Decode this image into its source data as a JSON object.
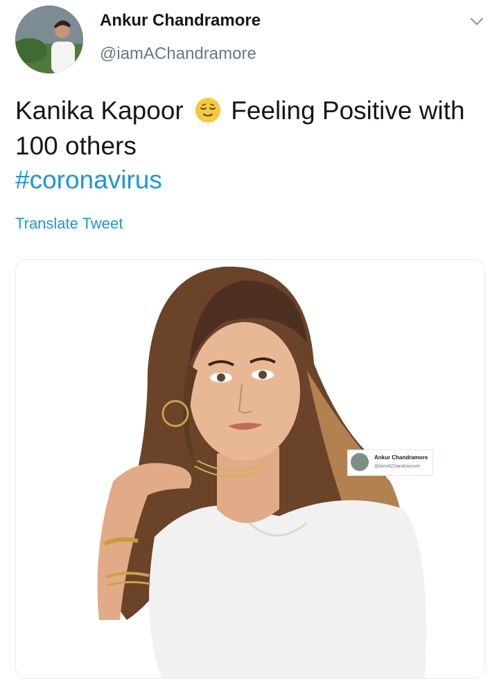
{
  "tweet": {
    "author": {
      "display_name": "Ankur Chandramore",
      "handle": "@iamAChandramore"
    },
    "text_before_emoji": "Kanika Kapoor",
    "emoji": "relieved-face-emoji",
    "text_after_emoji": "Feeling Positive with 100 others",
    "hashtag": "#coronavirus",
    "translate_label": "Translate Tweet",
    "link_color": "#1b95e0"
  },
  "media": {
    "watermark": {
      "display_name": "Ankur Chandramore",
      "handle": "@iamAChandramore"
    }
  }
}
